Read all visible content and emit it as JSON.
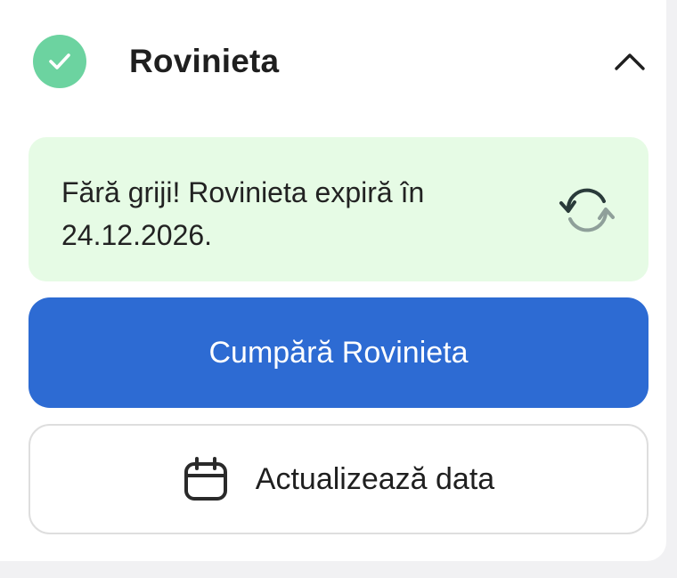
{
  "header": {
    "title": "Rovinieta",
    "check_icon": "check-circle-icon",
    "toggle_icon": "chevron-up-icon"
  },
  "status": {
    "message_line1": "Fără griji! Rovinieta expiră în",
    "message_line2": "24.12.2026.",
    "refresh_icon": "refresh-icon"
  },
  "actions": {
    "buy_label": "Cumpără Rovinieta",
    "update_label": "Actualizează data",
    "update_icon": "calendar-icon"
  },
  "colors": {
    "accent": "#2d6bd3",
    "success": "#6cd3a0",
    "status_bg": "#e6fbe5"
  }
}
